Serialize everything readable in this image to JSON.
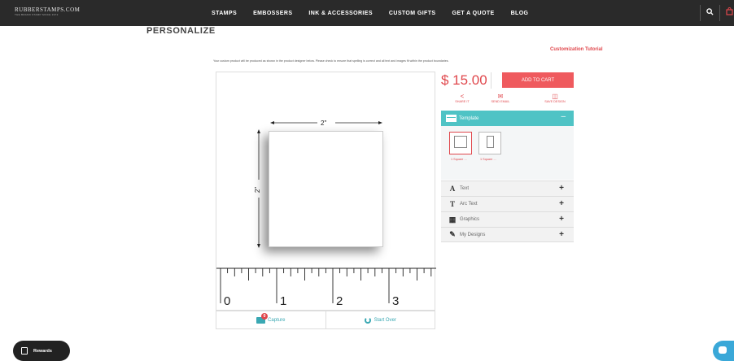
{
  "header": {
    "logo": "RUBBERSTAMPS.COM",
    "tagline": "THE BRAND STAMP SINCE 1972",
    "nav": [
      "STAMPS",
      "EMBOSSERS",
      "INK & ACCESSORIES",
      "CUSTOM GIFTS",
      "GET A QUOTE",
      "BLOG"
    ]
  },
  "page": {
    "title": "PERSONALIZE",
    "tutorial_link": "Customization Tutorial",
    "notice": "Your custom product will be produced as shown in the product designer below. Please check to ensure that spelling is correct and all text and images fit within the product boundaries."
  },
  "designer": {
    "width_label": "2\"",
    "height_label": "2\"",
    "ruler_numbers": [
      "0",
      "1",
      "2",
      "3"
    ],
    "capture_label": "Capture",
    "capture_badge": "0",
    "start_over_label": "Start Over"
  },
  "sidebar": {
    "price": "$ 15.00",
    "add_to_cart": "ADD TO CART",
    "share": "SHARE IT",
    "send_email": "SEND EMAIL",
    "save_design": "SAVE DESIGN",
    "template_header": "Template",
    "templates": [
      {
        "label": "1 Square ..."
      },
      {
        "label": "1 Square ..."
      }
    ],
    "accordion": [
      {
        "label": "Text",
        "icon": "text-icon"
      },
      {
        "label": "Arc Text",
        "icon": "arc-text-icon"
      },
      {
        "label": "Graphics",
        "icon": "image-icon"
      },
      {
        "label": "My Designs",
        "icon": "designs-icon"
      }
    ]
  },
  "widgets": {
    "rewards": "Rewards"
  },
  "colors": {
    "accent_red": "#e0474c",
    "teal": "#4fc3c5",
    "nav_bg": "#2a2a2a"
  }
}
